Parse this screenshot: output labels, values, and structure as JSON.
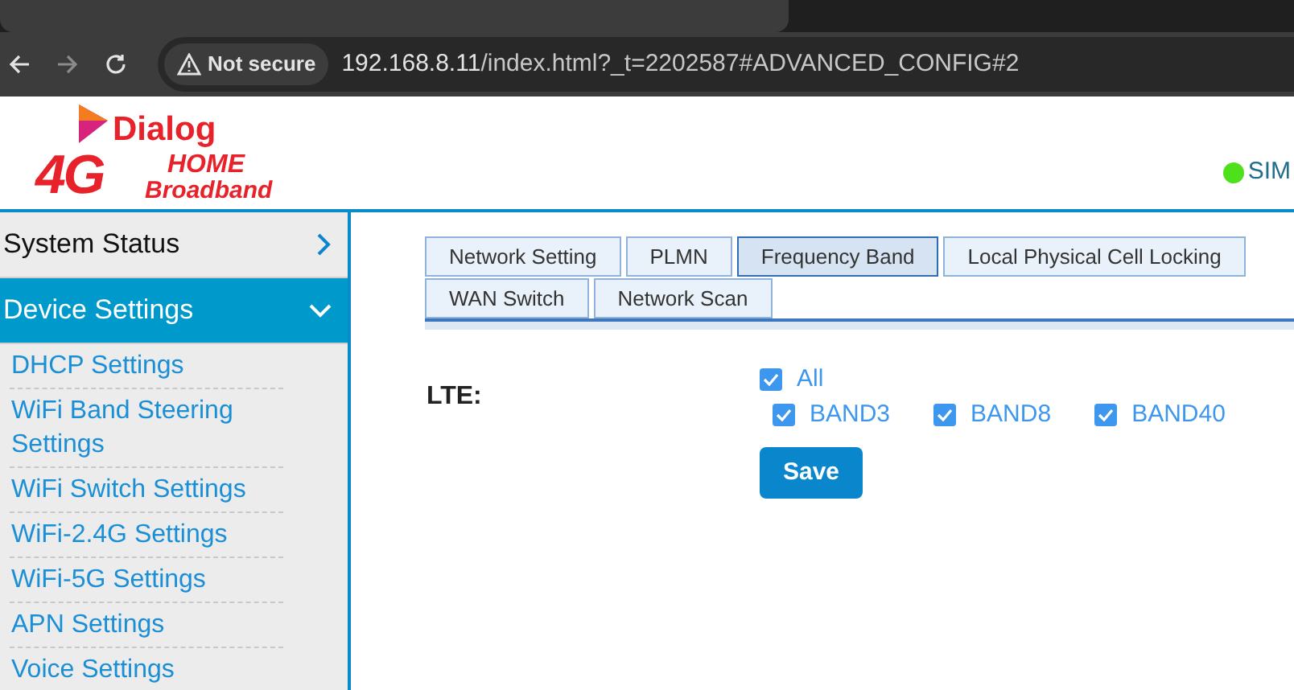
{
  "browser": {
    "security": "Not secure",
    "url_host": "192.168.8.11",
    "url_path": "/index.html?_t=2202587#ADVANCED_CONFIG#2"
  },
  "header": {
    "brand": "Dialog",
    "logo_big": "4G",
    "logo_home": "HOME",
    "logo_sub": "Broadband",
    "sim_label": "SIM",
    "sim_ok": true
  },
  "sidebar": {
    "items": [
      {
        "label": "System Status",
        "expanded": false
      },
      {
        "label": "Device Settings",
        "expanded": true,
        "children": [
          {
            "label": "DHCP Settings"
          },
          {
            "label": "WiFi Band Steering Settings"
          },
          {
            "label": "WiFi Switch Settings"
          },
          {
            "label": "WiFi-2.4G Settings"
          },
          {
            "label": "WiFi-5G Settings"
          },
          {
            "label": "APN Settings"
          },
          {
            "label": "Voice Settings"
          }
        ]
      }
    ]
  },
  "tabs": [
    {
      "label": "Network Setting",
      "selected": false
    },
    {
      "label": "PLMN",
      "selected": false
    },
    {
      "label": "Frequency Band",
      "selected": true
    },
    {
      "label": "Local Physical Cell Locking",
      "selected": false
    },
    {
      "label": "WAN Switch",
      "selected": false
    },
    {
      "label": "Network Scan",
      "selected": false
    }
  ],
  "lte": {
    "label": "LTE:",
    "all": {
      "label": "All",
      "checked": true
    },
    "bands": [
      {
        "label": "BAND3",
        "checked": true
      },
      {
        "label": "BAND8",
        "checked": true
      },
      {
        "label": "BAND40",
        "checked": true
      }
    ]
  },
  "save_button": "Save"
}
